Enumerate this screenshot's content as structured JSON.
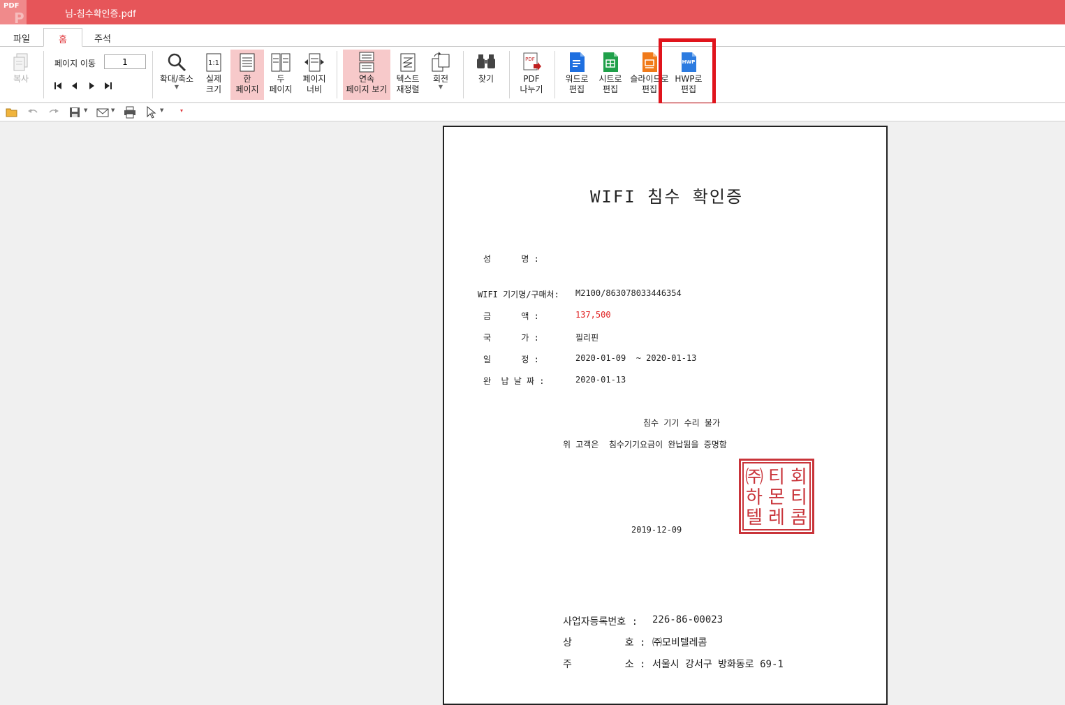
{
  "window": {
    "app_logo": "PDF",
    "app_logo_letter": "P",
    "title": "님-침수확인증.pdf"
  },
  "tabs": [
    {
      "label": "파일",
      "active": false
    },
    {
      "label": "홈",
      "active": true
    },
    {
      "label": "주석",
      "active": false
    }
  ],
  "ribbon": {
    "copy": "복사",
    "page_move_label": "페이지 이동",
    "page_number": "1",
    "zoom": "확대/축소",
    "actual_size": [
      "실제",
      "크기"
    ],
    "one_page": [
      "한",
      "페이지"
    ],
    "two_page": [
      "두",
      "페이지"
    ],
    "page_width": [
      "페이지",
      "너비"
    ],
    "continuous": [
      "연속",
      "페이지 보기"
    ],
    "reflow": [
      "텍스트",
      "재정렬"
    ],
    "rotate": "회전",
    "find": "찾기",
    "split_pdf": [
      "PDF",
      "나누기"
    ],
    "to_word": [
      "워드로",
      "편집"
    ],
    "to_sheet": [
      "시트로",
      "편집"
    ],
    "to_slide": [
      "슬라이드로",
      "편집"
    ],
    "to_hwp": [
      "HWP로",
      "편집"
    ],
    "hwp_icon_text": "HWP",
    "pdf_icon_text": "PDF"
  },
  "document": {
    "title": "WIFI 침수 확인증",
    "name_label": "성      명 :",
    "device_label": "WIFI 기기명/구매처:",
    "device_value": "M2100/863078033446354",
    "amount_label": "금      액 :",
    "amount_value": "137,500",
    "country_label": "국      가 :",
    "country_value": "필리핀",
    "schedule_label": "일      정 :",
    "schedule_value": "2020-01-09  ~ 2020-01-13",
    "paid_label": "완  납 날 짜 :",
    "paid_value": "2020-01-13",
    "note1": "침수 기기 수리 불가",
    "note2": "위 고객은  침수기기요금이 완납됨을 증명함",
    "issue_date": "2019-12-09",
    "seal_chars": [
      "㈜",
      "티",
      "회",
      "하",
      "몬",
      "티",
      "텔",
      "레",
      "콤"
    ],
    "biz_no_label": "사업자등록번호 :",
    "biz_no_value": "226-86-00023",
    "company_label": "상         호 :",
    "company_value": "㈜모비텔레콤",
    "address_label": "주         소 :",
    "address_value": "서울시 강서구 방화동로 69-1"
  },
  "colors": {
    "titlebar": "#e65559",
    "accent": "#e0393e",
    "highlight_box": "#e0141c",
    "active_button": "#f7c9ca",
    "seal": "#c9343a"
  }
}
